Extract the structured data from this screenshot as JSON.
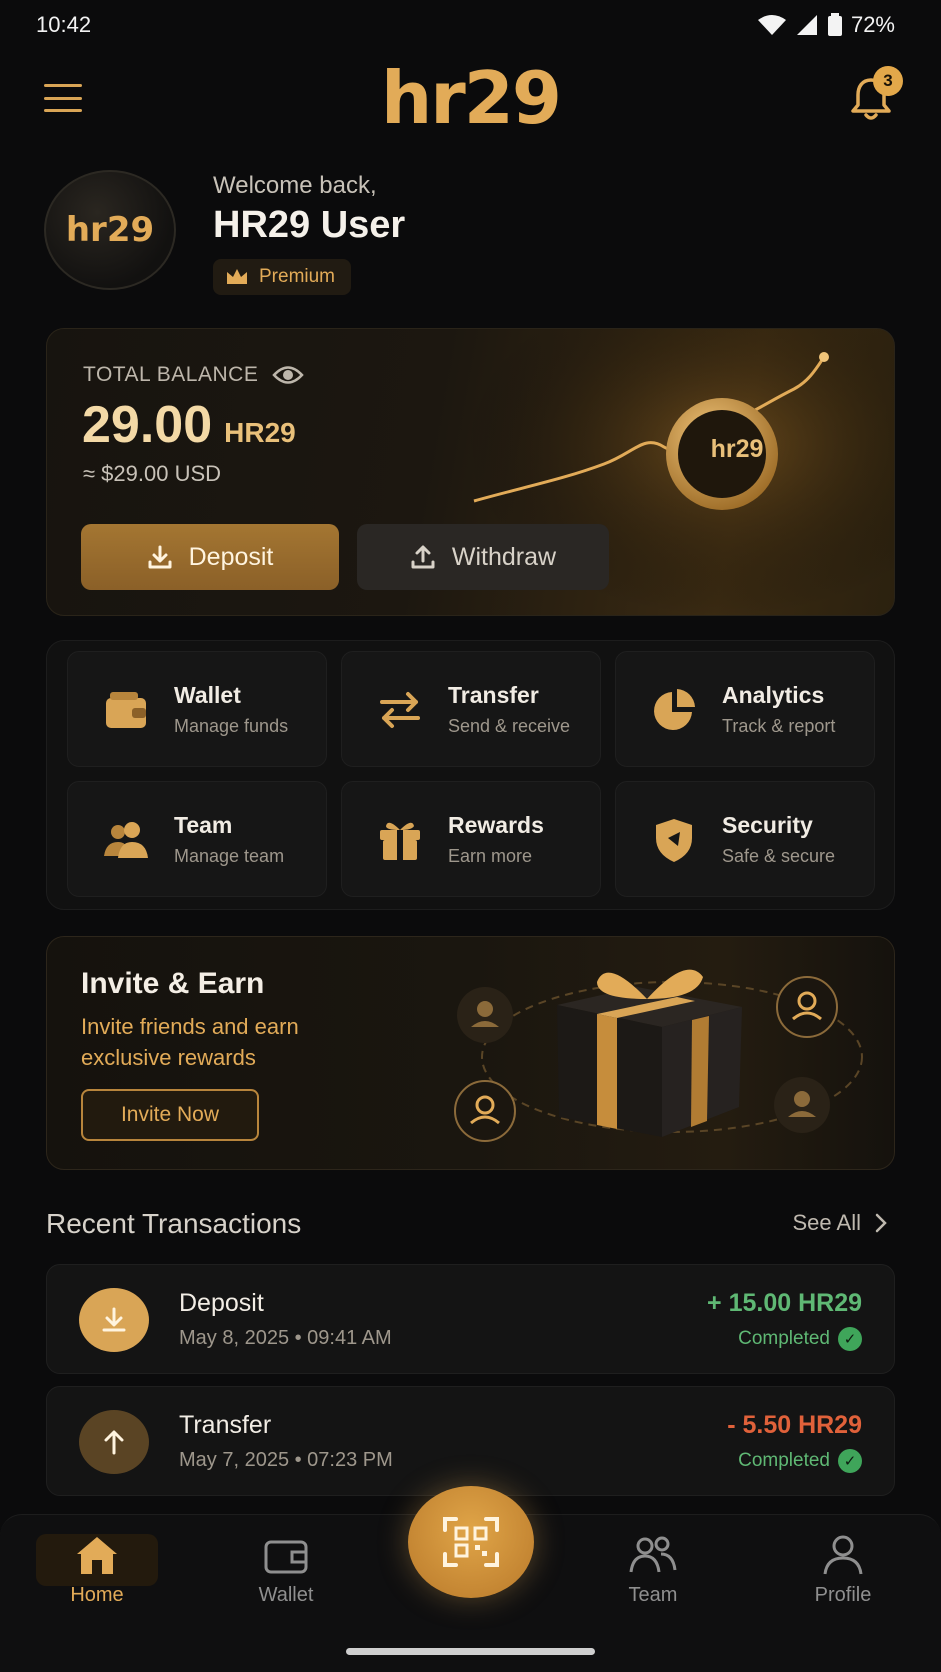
{
  "status": {
    "time": "10:42",
    "battery": "72%"
  },
  "header": {
    "logo": "hr29",
    "notification_count": "3"
  },
  "profile": {
    "avatar_text": "hr29",
    "welcome": "Welcome back,",
    "name": "HR29 User",
    "badge": "Premium"
  },
  "balance": {
    "label": "TOTAL BALANCE",
    "amount": "29.00",
    "currency": "HR29",
    "usd": "≈ $29.00 USD",
    "coin_text": "hr29",
    "deposit_label": "Deposit",
    "withdraw_label": "Withdraw"
  },
  "quick_actions": [
    {
      "title": "Wallet",
      "subtitle": "Manage funds",
      "icon": "wallet-icon"
    },
    {
      "title": "Transfer",
      "subtitle": "Send & receive",
      "icon": "transfer-icon"
    },
    {
      "title": "Analytics",
      "subtitle": "Track & report",
      "icon": "pie-chart-icon"
    },
    {
      "title": "Team",
      "subtitle": "Manage team",
      "icon": "team-icon"
    },
    {
      "title": "Rewards",
      "subtitle": "Earn more",
      "icon": "gift-icon"
    },
    {
      "title": "Security",
      "subtitle": "Safe & secure",
      "icon": "shield-icon"
    }
  ],
  "invite": {
    "title": "Invite & Earn",
    "subtitle": "Invite friends and earn exclusive rewards",
    "button": "Invite Now"
  },
  "recent": {
    "title": "Recent Transactions",
    "see_all": "See All",
    "items": [
      {
        "name": "Deposit",
        "date": "May 8, 2025 • 09:41 AM",
        "amount": "+ 15.00 HR29",
        "status": "Completed",
        "amount_color": "#5fb874"
      },
      {
        "name": "Transfer",
        "date": "May 7, 2025 • 07:23 PM",
        "amount": "- 5.50 HR29",
        "status": "Completed",
        "amount_color": "#e0613a"
      }
    ]
  },
  "nav": {
    "home": "Home",
    "wallet": "Wallet",
    "team": "Team",
    "profile": "Profile"
  },
  "colors": {
    "accent": "#e2ab58",
    "background": "#0b0b0c",
    "success": "#5fb874",
    "negative": "#e0613a"
  }
}
